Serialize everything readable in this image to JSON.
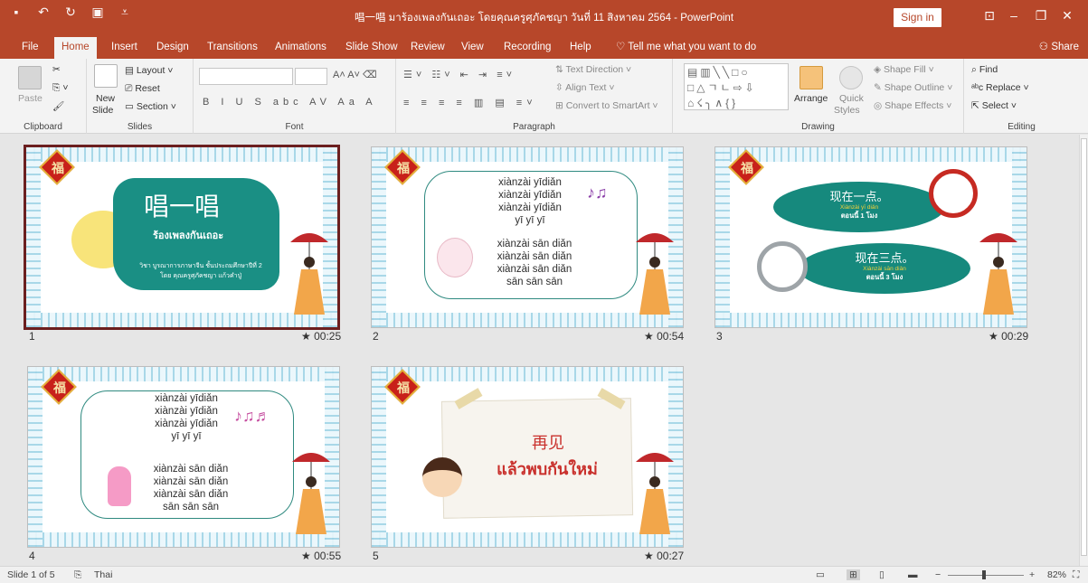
{
  "window": {
    "title": "唱一唱 มาร้องเพลงกันเถอะ โดยคุณครูศุภัคชญา วันที่ 11 สิงหาคม 2564 - PowerPoint",
    "sign_in": "Sign in"
  },
  "tabs": [
    "File",
    "Home",
    "Insert",
    "Design",
    "Transitions",
    "Animations",
    "Slide Show",
    "Review",
    "View",
    "Recording",
    "Help"
  ],
  "tell_me": "Tell me what you want to do",
  "share": "Share",
  "ribbon": {
    "clipboard": {
      "label": "Clipboard",
      "paste": "Paste"
    },
    "slides": {
      "label": "Slides",
      "new_slide": "New",
      "new_slide2": "Slide",
      "layout": "Layout",
      "reset": "Reset",
      "section": "Section"
    },
    "font": {
      "label": "Font"
    },
    "paragraph": {
      "label": "Paragraph",
      "text_direction": "Text Direction",
      "align_text": "Align Text",
      "convert": "Convert to SmartArt"
    },
    "drawing": {
      "label": "Drawing",
      "arrange": "Arrange",
      "quick_styles": "Quick",
      "quick_styles2": "Styles",
      "shape_fill": "Shape Fill",
      "shape_outline": "Shape Outline",
      "shape_effects": "Shape Effects"
    },
    "editing": {
      "label": "Editing",
      "find": "Find",
      "replace": "Replace",
      "select": "Select"
    }
  },
  "slides": [
    {
      "num": "1",
      "time": "00:25",
      "title": "唱一唱",
      "subtitle": "ร้องเพลงกันเถอะ",
      "line1": "วิชา บูรณาการภาษาจีน  ชั้นประถมศึกษาปีที่ 2",
      "line2": "โดย คุณครูศุภัคชญา  แก้วคำปู่"
    },
    {
      "num": "2",
      "time": "00:54",
      "lines_a": [
        "xiànzài yīdiǎn",
        "xiànzài yīdiǎn",
        "xiànzài yīdiǎn",
        "yī yī yī"
      ],
      "lines_b": [
        "xiànzài sān diǎn",
        "xiànzài sān diǎn",
        "xiànzài sān diǎn",
        "sān sān sān"
      ]
    },
    {
      "num": "3",
      "time": "00:29",
      "oval1_cn": "现在一点。",
      "oval1_py": "Xiànzài yī diǎn",
      "oval1_th": "ตอนนี้ 1 โมง",
      "oval2_cn": "现在三点。",
      "oval2_py": "Xiànzài sān diǎn",
      "oval2_th": "ตอนนี้ 3 โมง"
    },
    {
      "num": "4",
      "time": "00:55",
      "lines_a": [
        "xiànzài yīdiǎn",
        "xiànzài yīdiǎn",
        "xiànzài yīdiǎn",
        "yī yī yī"
      ],
      "lines_b": [
        "xiànzài sān diǎn",
        "xiànzài sān diǎn",
        "xiànzài sān diǎn",
        "sān sān sān"
      ]
    },
    {
      "num": "5",
      "time": "00:27",
      "cn": "再见",
      "th": "แล้วพบกันใหม่"
    }
  ],
  "status": {
    "slide_of": "Slide 1 of 5",
    "language": "Thai",
    "zoom": "82%"
  },
  "fu_char": "福",
  "accent_color": "#b7472a"
}
